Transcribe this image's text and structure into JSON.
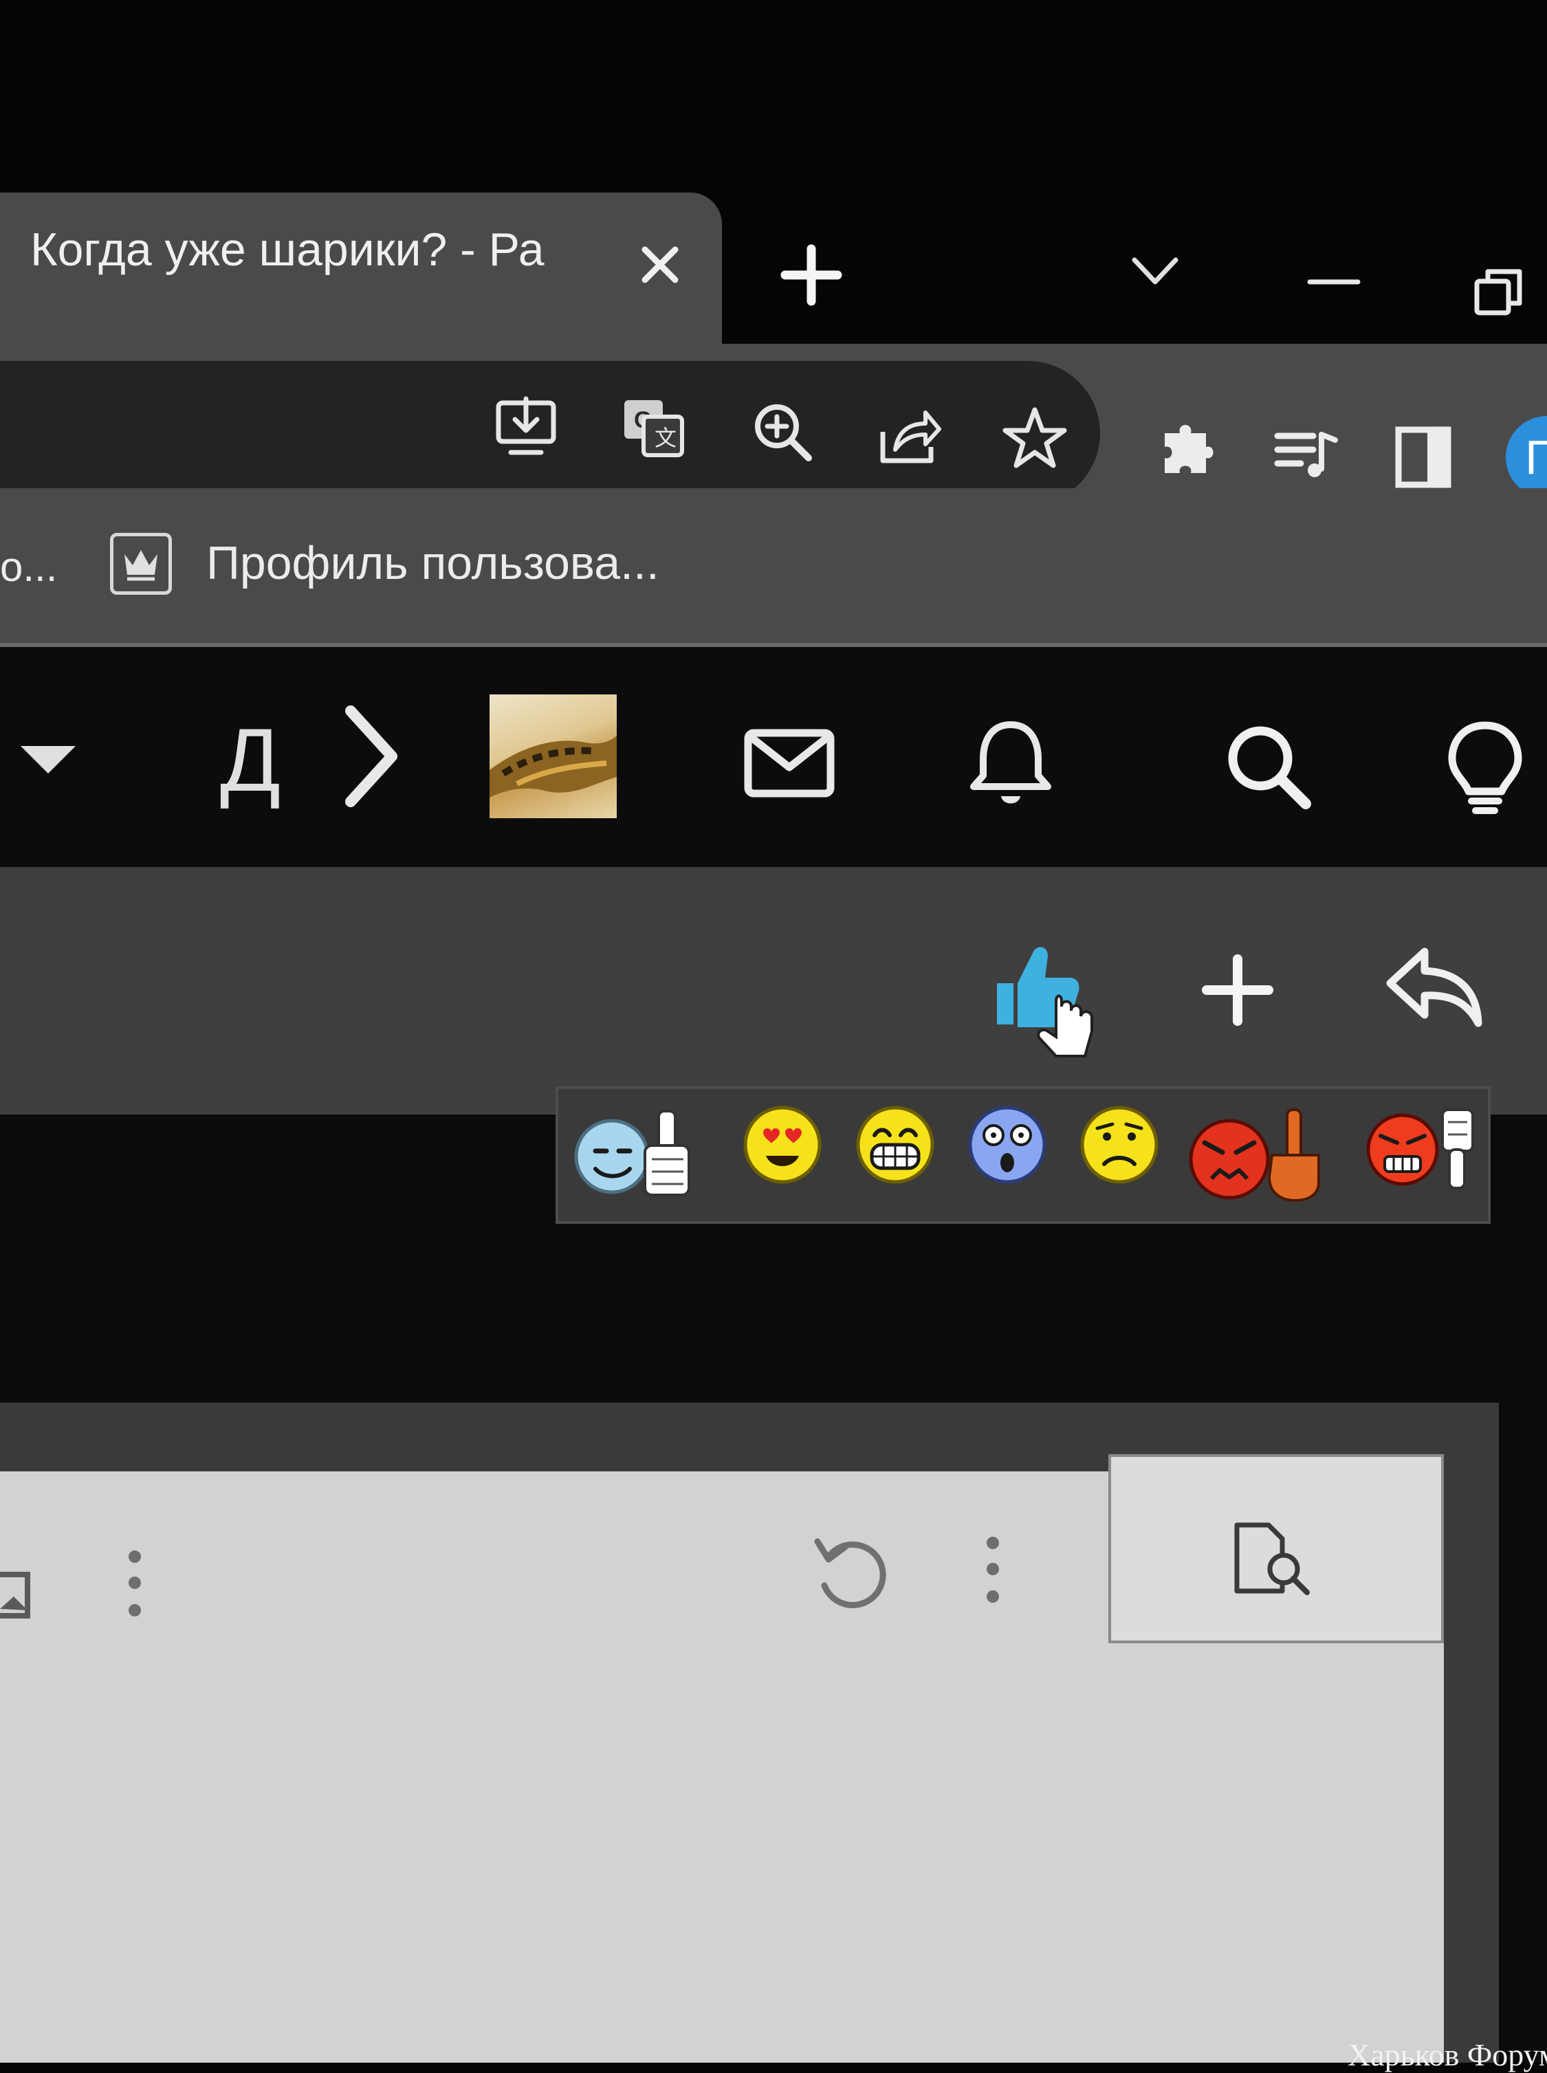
{
  "browser": {
    "tab": {
      "title": "Когда уже шарики? - Ра"
    },
    "bookmarks": [
      {
        "label": "о..."
      },
      {
        "label": "Профиль пользова..."
      }
    ],
    "profile_initial": "Г"
  },
  "forum": {
    "nav_letter": "Д"
  },
  "watermark": "Харьков Форум",
  "colors": {
    "tab_active": "#4a4a4a",
    "omnibox": "#232323",
    "like_accent": "#3eb1df",
    "profile_badge": "#2b8fdc"
  },
  "icons": {
    "toolbar": [
      "install-app-icon",
      "translate-icon",
      "zoom-icon",
      "share-icon",
      "bookmark-star-icon",
      "extensions-icon",
      "media-control-icon",
      "side-panel-icon"
    ],
    "navbar": [
      "dropdown-caret-icon",
      "chevron-right-icon",
      "mail-icon",
      "bell-icon",
      "search-icon",
      "lightbulb-icon"
    ],
    "reactions": [
      "thumbs-up-smiley",
      "heart-eyes-smiley",
      "grin-smiley",
      "shocked-smiley",
      "sad-smiley",
      "angry-middle-finger-smiley",
      "angry-thumbs-down-smiley"
    ]
  }
}
